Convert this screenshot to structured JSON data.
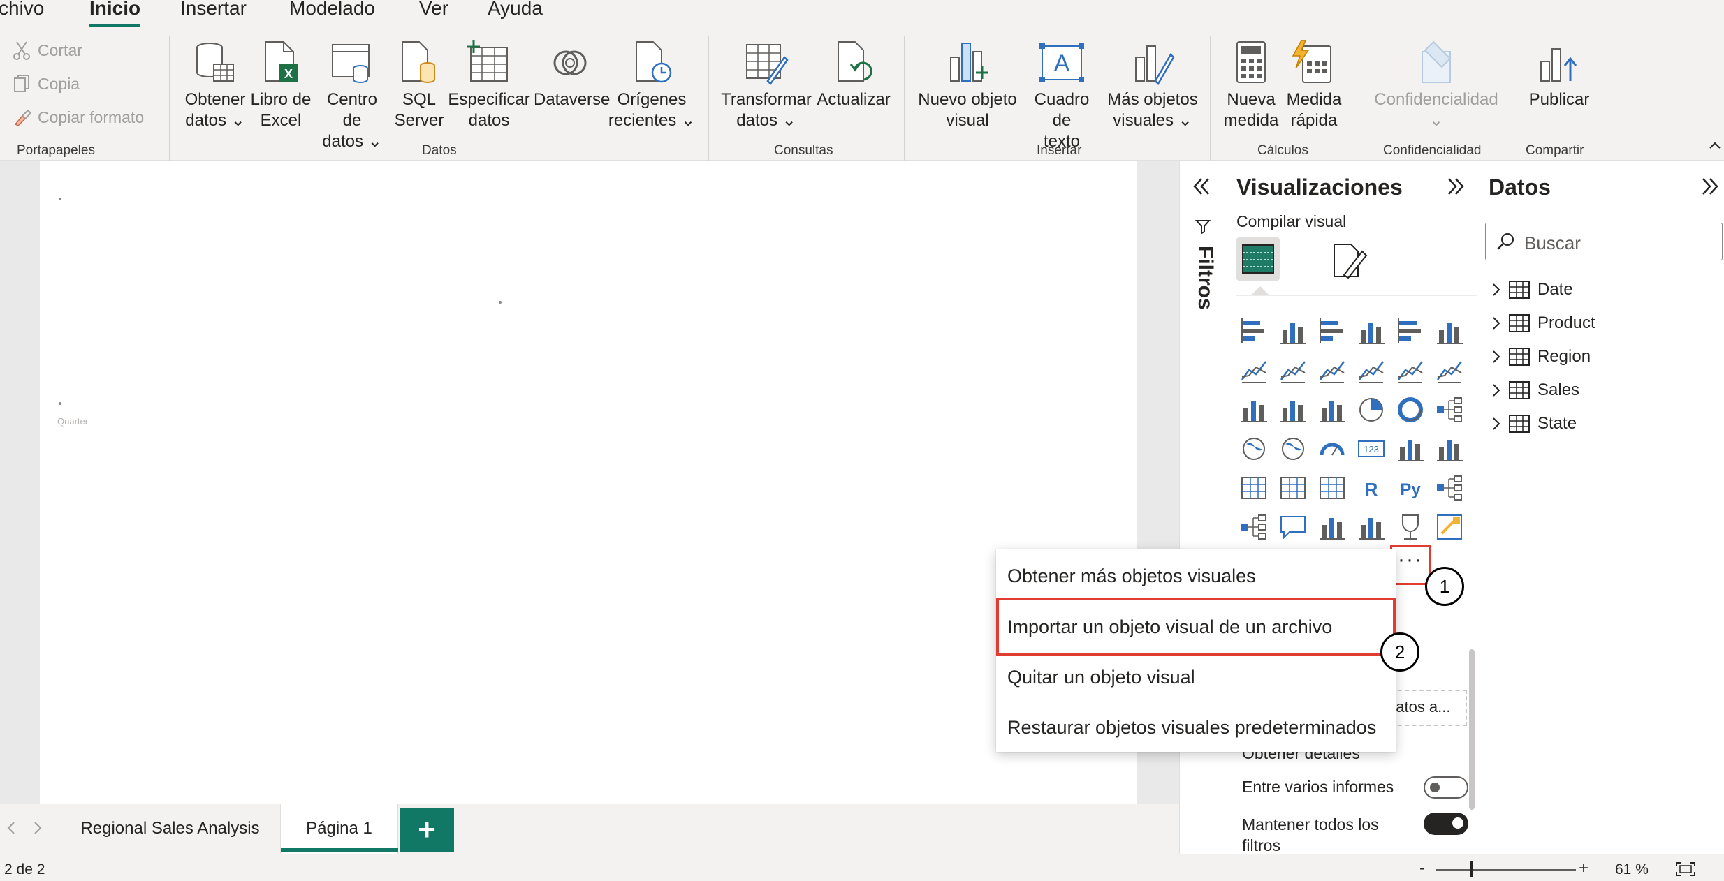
{
  "menu": {
    "tabs": [
      "chivo",
      "Inicio",
      "Insertar",
      "Modelado",
      "Ver",
      "Ayuda"
    ],
    "active": "Inicio"
  },
  "ribbon": {
    "clipboard": {
      "cut": "Cortar",
      "copy": "Copia",
      "format": "Copiar formato",
      "group": "Portapapeles"
    },
    "data": {
      "group": "Datos",
      "get_data": "Obtener\ndatos ⌄",
      "excel": "Libro de\nExcel",
      "hub": "Centro de\ndatos ⌄",
      "sql": "SQL\nServer",
      "enter": "Especificar\ndatos",
      "dataverse": "Dataverse",
      "recent": "Orígenes\nrecientes ⌄"
    },
    "queries": {
      "group": "Consultas",
      "transform": "Transformar\ndatos ⌄",
      "refresh": "Actualizar"
    },
    "insert": {
      "group": "Insertar",
      "new_visual": "Nuevo objeto\nvisual",
      "text_box": "Cuadro de\ntexto",
      "more_visuals": "Más objetos\nvisuales ⌄"
    },
    "calculations": {
      "group": "Cálculos",
      "new_measure": "Nueva\nmedida",
      "quick_measure": "Medida\nrápida"
    },
    "sensitivity": {
      "group": "Confidencialidad",
      "label": "Confidencialidad\n⌄"
    },
    "share": {
      "group": "Compartir",
      "publish": "Publicar"
    }
  },
  "canvas": {
    "placeholder": "Quarter"
  },
  "filters": {
    "label": "Filtros"
  },
  "visualizations": {
    "title": "Visualizaciones",
    "build_label": "Compilar visual",
    "more_label": "···",
    "cross_report": "Entre varios informes",
    "keep_filters": "Mantener todos los\nfiltros",
    "drillthrough": "Obtener detalles",
    "drop_field": "datos a..."
  },
  "badges": {
    "one": "1",
    "two": "2"
  },
  "popup": {
    "items": [
      "Obtener más objetos visuales",
      "Importar un objeto visual de un archivo",
      "Quitar un objeto visual",
      "Restaurar objetos visuales predeterminados"
    ]
  },
  "data_pane": {
    "title": "Datos",
    "search_placeholder": "Buscar",
    "tables": [
      "Date",
      "Product",
      "Region",
      "Sales",
      "State"
    ]
  },
  "pages": {
    "tabs": [
      "Regional Sales Analysis",
      "Página 1"
    ],
    "active": "Página 1",
    "add": "+"
  },
  "status": {
    "page_count": "2 de 2",
    "zoom": "61 %",
    "minus": "-",
    "plus": "+"
  },
  "colors": {
    "accent": "#117865",
    "highlight": "#e03c31",
    "icon_blue": "#2f6fbd",
    "excel_green": "#1e7145"
  }
}
